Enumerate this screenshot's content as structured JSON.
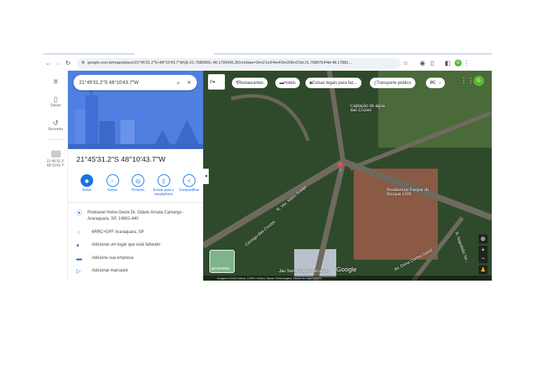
{
  "browser": {
    "url": "google.com.br/maps/place/21°45'31.2\"S+48°10'43.7\"W/@-21.7586909,-48.1799435,351m/data=!3m1!1e3!4m4!3m3!8m2!3d-21.7586754!4d-48.17881...",
    "profile_initial": "G"
  },
  "rail": {
    "saved": "Salvos",
    "recent": "Recentes",
    "recent_item": "21°45'31.2\" 48°10'43.7\""
  },
  "search": {
    "value": "21°45'31.2\"S 48°10'43.7\"W"
  },
  "place": {
    "title": "21°45'31.2\"S 48°10'43.7\"W"
  },
  "actions": [
    {
      "label": "Rotas"
    },
    {
      "label": "Salvar"
    },
    {
      "label": "Próximo"
    },
    {
      "label": "Enviar para o smartphone"
    },
    {
      "label": "Compartilhar"
    }
  ],
  "details": [
    {
      "icon": "pin",
      "text": "Rodoanel Norte-Oeste Dr. Otávio Arruda Camargo - Araraquara, SP, 14802-440"
    },
    {
      "icon": "plus-code",
      "text": "6RRC+GFF Araraquara, SP"
    },
    {
      "icon": "add-place",
      "text": "Adicionar um lugar que está faltando"
    },
    {
      "icon": "business",
      "text": "Adicione sua empresa"
    },
    {
      "icon": "label",
      "text": "Adicionar marcador"
    }
  ],
  "map": {
    "chips": [
      "Restaurantes",
      "Hotéis",
      "Coisas legais para faz...",
      "Transporte público",
      "E"
    ],
    "layer_label": "Camadas",
    "labels": [
      "Captação de água das Cruzes",
      "Residencial Parque do Bosque 1505",
      "R. Ver. Mário Araújo",
      "Córrego das Cruzes",
      "Av. Dona Conha David",
      "R. Napoleão Se...",
      "Jau Serve Supermercados"
    ],
    "logo": "Google",
    "footer": "Imagens ©2024 Airbus, CNES / Airbus, Maxar Technologies, Dados do mapa ©2024"
  }
}
